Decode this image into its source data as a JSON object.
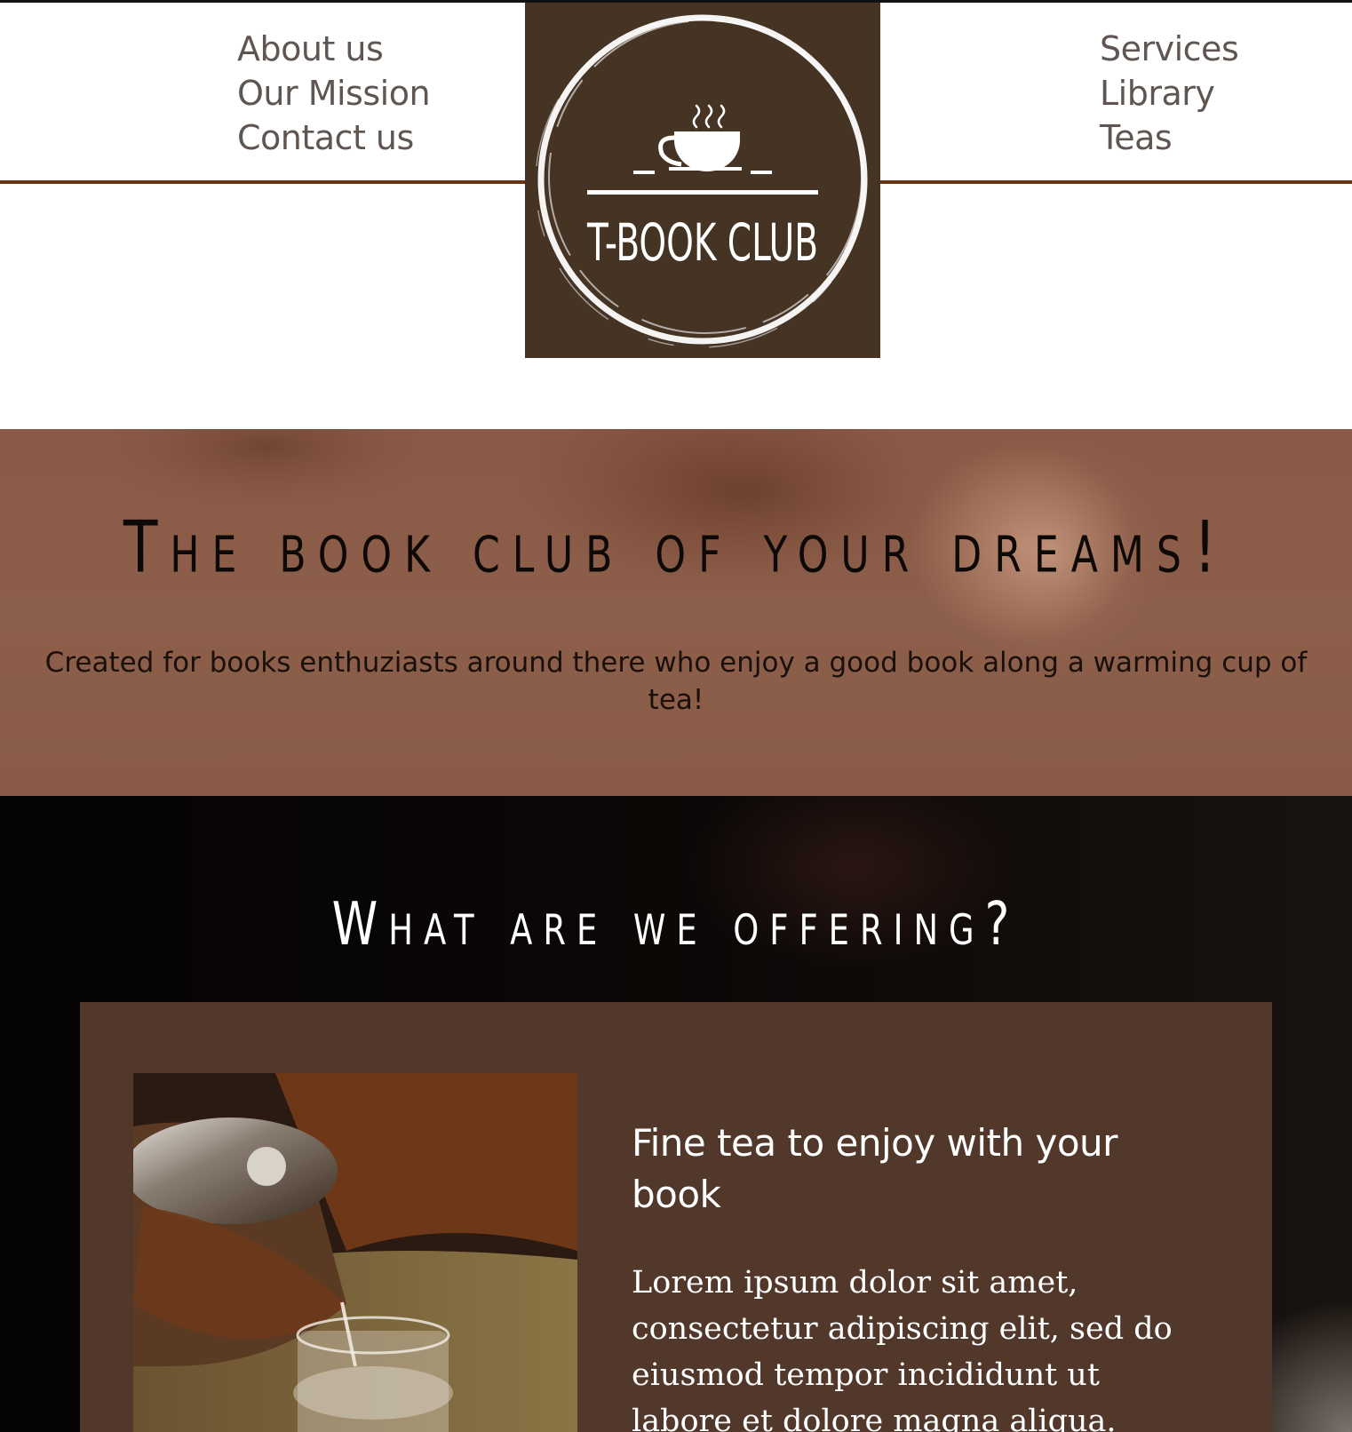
{
  "nav": {
    "left": [
      "About us",
      "Our Mission",
      "Contact us"
    ],
    "right": [
      "Services",
      "Library",
      "Teas"
    ]
  },
  "logo": {
    "text": "T-BOOK CLUB"
  },
  "hero": {
    "title": "The book club of your dreams!",
    "subtitle": "Created for books enthuziasts around there who enjoy a good book along a warming cup of tea!"
  },
  "offer": {
    "title": "What are we offering?",
    "card": {
      "heading": "Fine tea to enjoy with your book",
      "text": "Lorem ipsum dolor sit amet, consectetur adipiscing elit, sed do eiusmod tempor incididunt ut labore et dolore magna aliqua."
    }
  },
  "colors": {
    "brand_brown": "#453324",
    "rule": "#6b3513",
    "nav_text": "#5f5652",
    "hero_bg": "#8a5a46",
    "card_bg": "#51382b"
  }
}
